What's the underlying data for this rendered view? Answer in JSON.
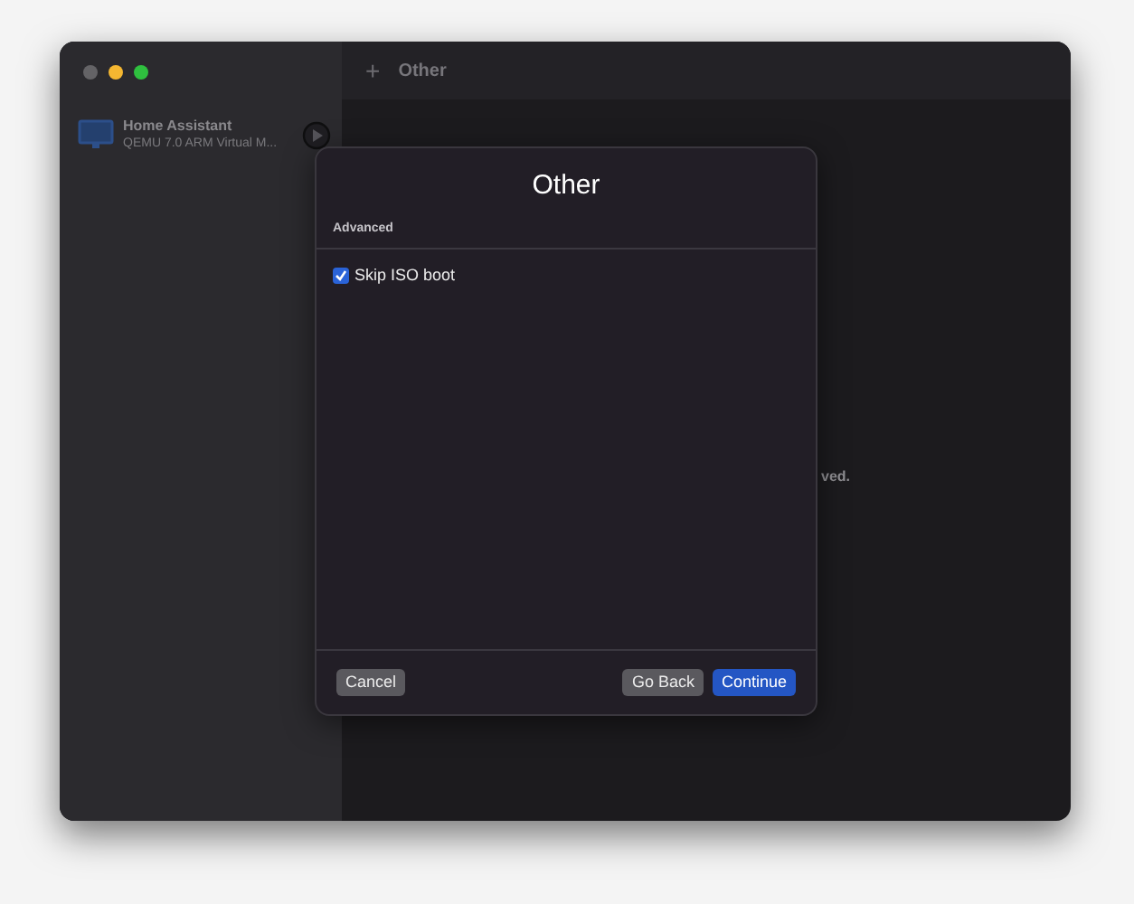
{
  "sidebar": {
    "items": [
      {
        "title": "Home Assistant",
        "subtitle": "QEMU 7.0 ARM Virtual M...",
        "selected": false
      }
    ]
  },
  "toolbar": {
    "add": "+",
    "title": "Other"
  },
  "main": {
    "message": "ved."
  },
  "dialog": {
    "title": "Other",
    "section": "Advanced",
    "options": [
      {
        "label": "Skip ISO boot",
        "checked": true
      }
    ],
    "buttons": [
      {
        "label": "Cancel",
        "kind": "secondary"
      },
      {
        "label": "Go Back",
        "kind": "secondary"
      },
      {
        "label": "Continue",
        "kind": "primary"
      }
    ]
  }
}
